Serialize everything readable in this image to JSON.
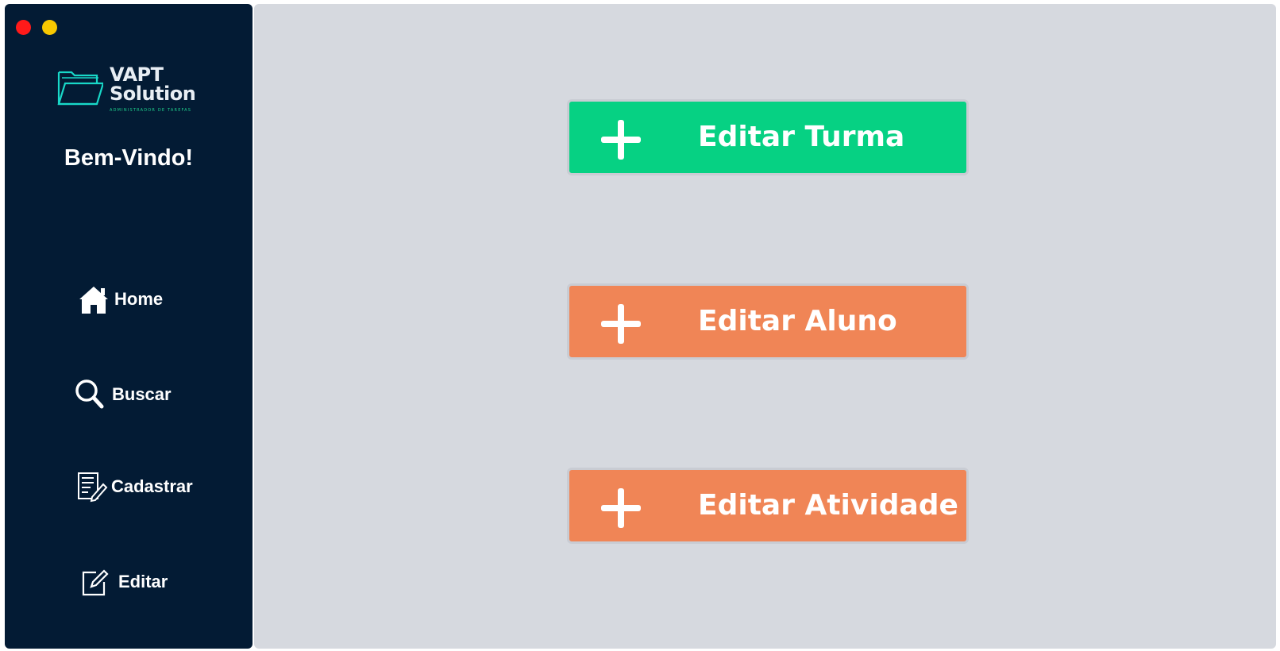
{
  "window": {
    "controls": [
      "close-dot",
      "minimize-dot"
    ]
  },
  "logo": {
    "line1": "VAPT",
    "line2": "Solution",
    "tagline": "ADMINISTRADOR DE TAREFAS"
  },
  "sidebar": {
    "welcome": "Bem-Vindo!",
    "items": [
      {
        "label": "Home",
        "icon": "home-icon"
      },
      {
        "label": "Buscar",
        "icon": "search-icon"
      },
      {
        "label": "Cadastrar",
        "icon": "form-edit-icon"
      },
      {
        "label": "Editar",
        "icon": "edit-icon"
      }
    ]
  },
  "main": {
    "buttons": [
      {
        "label": "Editar Turma",
        "color": "#06d183",
        "icon": "plus-icon"
      },
      {
        "label": "Editar Aluno",
        "color": "#f08556",
        "icon": "plus-icon"
      },
      {
        "label": "Editar Atividade",
        "color": "#f08556",
        "icon": "plus-icon"
      }
    ]
  },
  "colors": {
    "sidebar_bg": "#031b34",
    "main_bg": "#d6d9df",
    "accent_green": "#06d183",
    "accent_orange": "#f08556"
  }
}
